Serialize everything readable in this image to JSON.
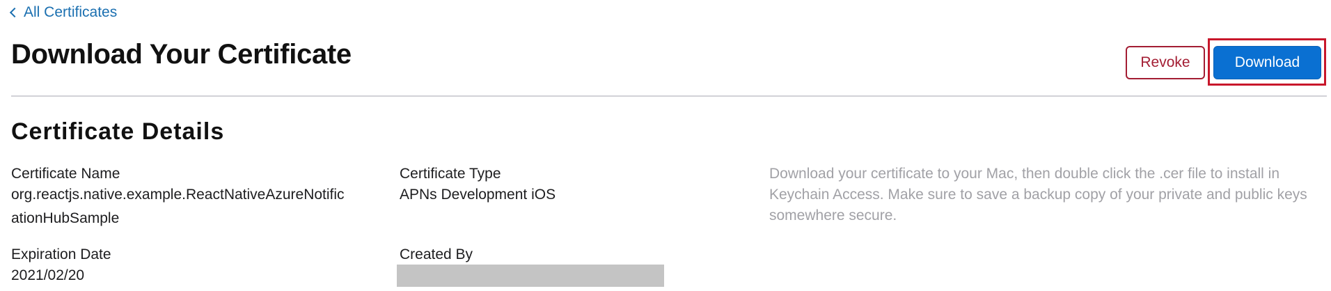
{
  "breadcrumb": {
    "back_label": "All Certificates"
  },
  "header": {
    "title": "Download Your Certificate",
    "revoke_label": "Revoke",
    "download_label": "Download"
  },
  "details": {
    "section_title": "Certificate Details",
    "certificate_name": {
      "label": "Certificate Name",
      "value_line1": "org.reactjs.native.example.ReactNativeAzureNotific",
      "value_line2": "ationHubSample"
    },
    "certificate_type": {
      "label": "Certificate Type",
      "value": "APNs Development iOS"
    },
    "expiration_date": {
      "label": "Expiration Date",
      "value": "2021/02/20"
    },
    "created_by": {
      "label": "Created By"
    },
    "info": "Download your certificate to your Mac, then double click the .cer file to install in Keychain Access. Make sure to save a backup copy of your private and public keys somewhere secure."
  },
  "colors": {
    "link": "#1a6fb0",
    "primary_button": "#0a70d2",
    "destructive": "#a31d33",
    "highlight": "#c8172b",
    "muted_text": "#a1a1a6"
  },
  "icons": {
    "back": "chevron-left-icon"
  }
}
